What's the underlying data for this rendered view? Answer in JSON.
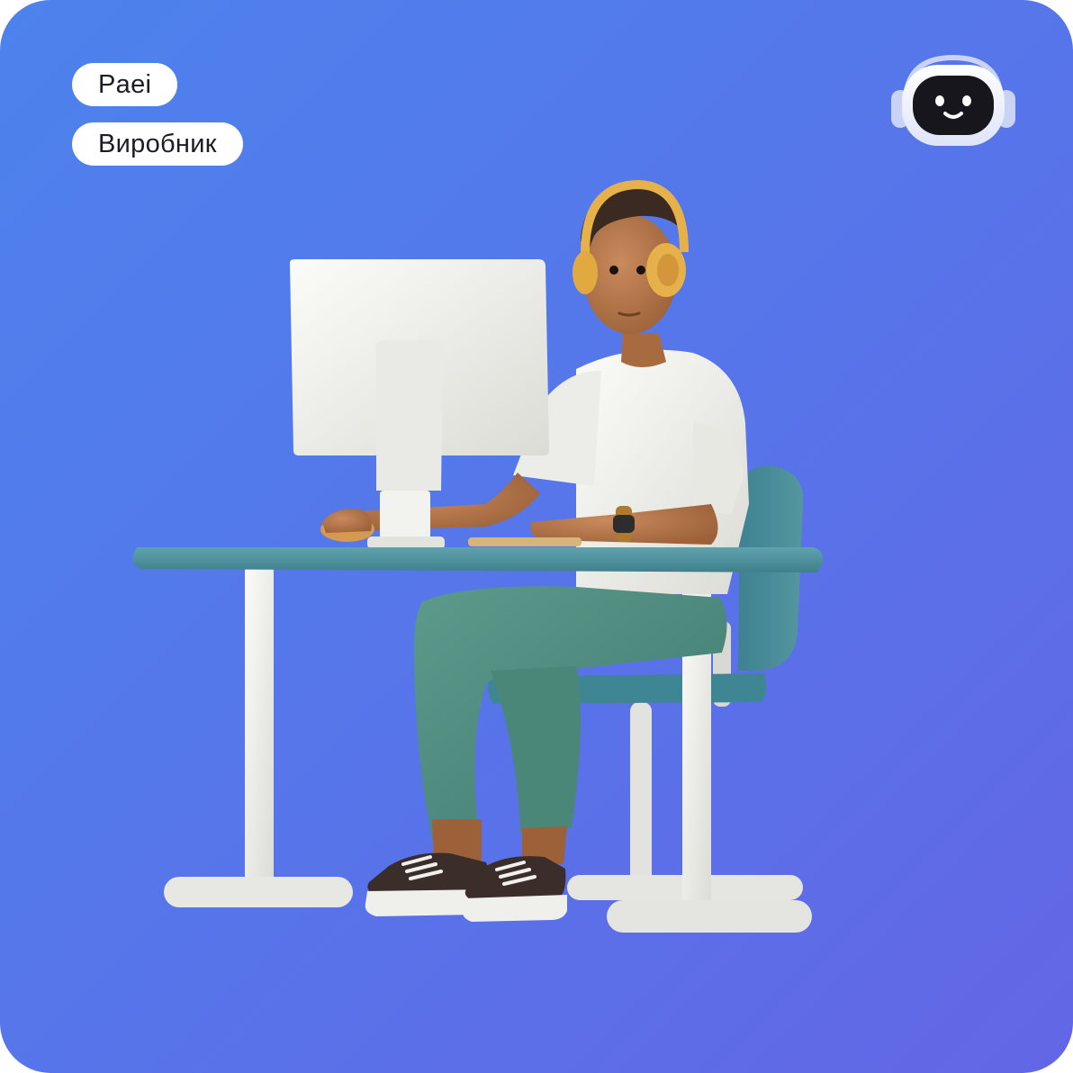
{
  "tags": {
    "series": "Paei",
    "role": "Виробник"
  },
  "logo": {
    "icon": "robot-headphones-icon"
  },
  "illustration": {
    "subject": "person-at-computer-illustration"
  },
  "colors": {
    "bg_start": "#4d82ec",
    "bg_end": "#6366e6",
    "desk": "#4f8f9c",
    "pants": "#4f8a7d",
    "shirt": "#f3f3f0",
    "headphones": "#e6b04a"
  }
}
